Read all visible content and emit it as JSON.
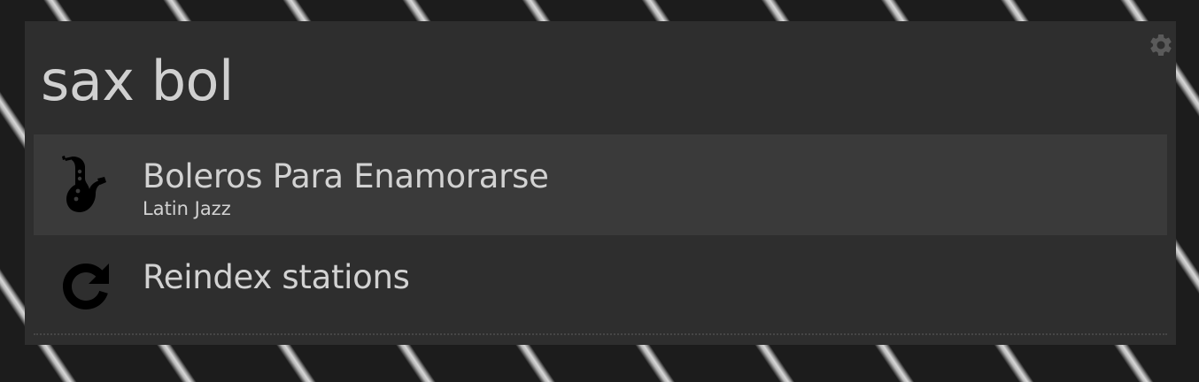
{
  "query": {
    "value": "sax bol"
  },
  "prefs": {
    "icon": "gear-icon",
    "color": "#5a5a5a"
  },
  "results": [
    {
      "icon": "saxophone-icon",
      "name": "Boleros Para Enamorarse",
      "description": "Latin Jazz",
      "selected": true
    },
    {
      "icon": "refresh-icon",
      "name": "Reindex stations",
      "selected": false
    }
  ],
  "colors": {
    "window_bg": "#2e2e2e",
    "selected_bg": "#3a3a3a",
    "text": "#d2d2d2"
  }
}
